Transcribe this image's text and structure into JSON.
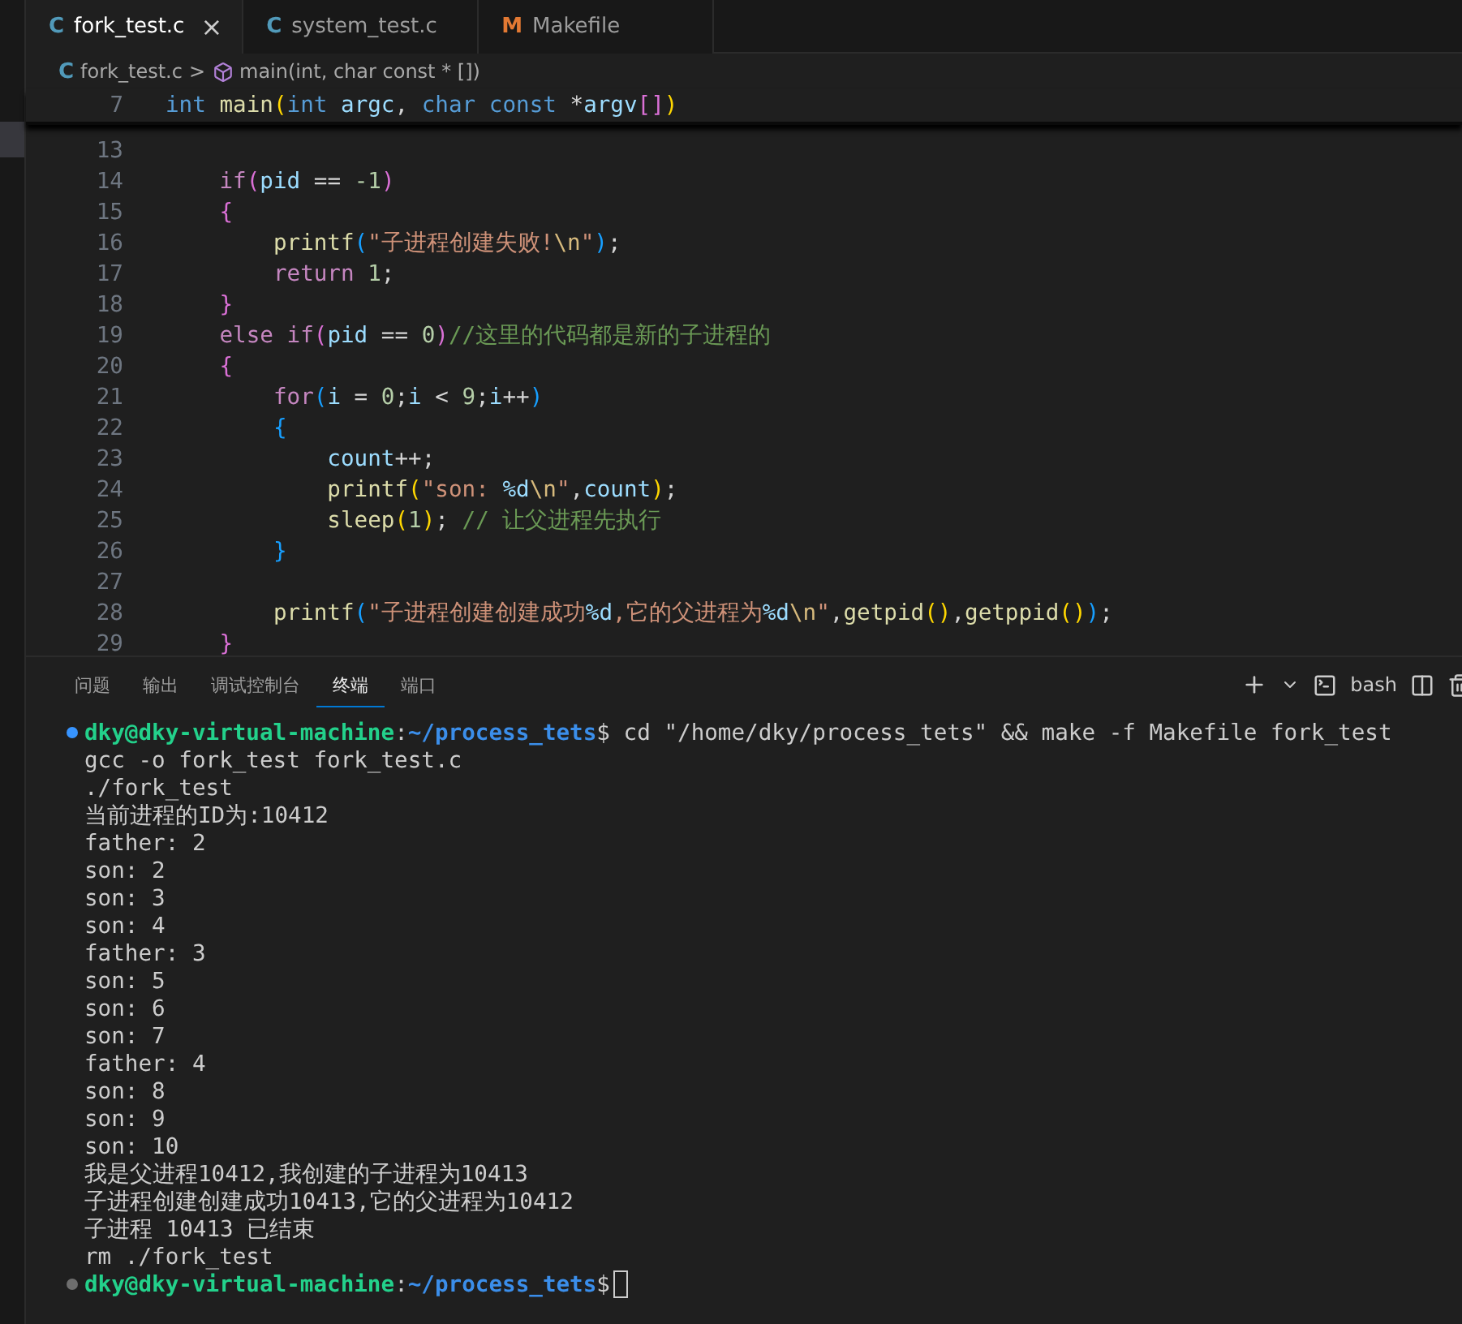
{
  "tabs": [
    {
      "icon": "C",
      "kind": "c",
      "label": "fork_test.c",
      "selected": true,
      "close": "×"
    },
    {
      "icon": "C",
      "kind": "c",
      "label": "system_test.c",
      "selected": false
    },
    {
      "icon": "M",
      "kind": "make",
      "label": "Makefile",
      "selected": false
    }
  ],
  "breadcrumb": {
    "icon": "C",
    "file": "fork_test.c",
    "separator": ">",
    "symbol": "main(int, char const * [])"
  },
  "sticky_line": {
    "number": "7",
    "tokens": [
      {
        "kind": "kw",
        "text": "int "
      },
      {
        "kind": "fn",
        "text": "main"
      },
      {
        "kind": "b1",
        "text": "("
      },
      {
        "kind": "kw",
        "text": "int "
      },
      {
        "kind": "var",
        "text": "argc"
      },
      {
        "kind": "op",
        "text": ", "
      },
      {
        "kind": "kw",
        "text": "char const "
      },
      {
        "kind": "op",
        "text": "*"
      },
      {
        "kind": "var",
        "text": "argv"
      },
      {
        "kind": "b2",
        "text": "[]"
      },
      {
        "kind": "b1",
        "text": ")"
      }
    ]
  },
  "code_lines": [
    {
      "number": "13"
    },
    {
      "number": "14",
      "tokens": [
        {
          "kind": "ctrl",
          "text": "    if"
        },
        {
          "kind": "b2",
          "text": "("
        },
        {
          "kind": "var",
          "text": "pid"
        },
        {
          "kind": "op",
          "text": " == "
        },
        {
          "kind": "num",
          "text": "-1"
        },
        {
          "kind": "b2",
          "text": ")"
        }
      ]
    },
    {
      "number": "15",
      "tokens": [
        {
          "kind": "b2",
          "text": "    {"
        }
      ]
    },
    {
      "number": "16",
      "tokens": [
        {
          "kind": "fn",
          "text": "        printf"
        },
        {
          "kind": "b3",
          "text": "("
        },
        {
          "kind": "str",
          "text": "\"子进程创建失败!"
        },
        {
          "kind": "esc",
          "text": "\\n"
        },
        {
          "kind": "str",
          "text": "\""
        },
        {
          "kind": "b3",
          "text": ")"
        },
        {
          "kind": "op",
          "text": ";"
        }
      ]
    },
    {
      "number": "17",
      "tokens": [
        {
          "kind": "ctrl",
          "text": "        return "
        },
        {
          "kind": "num",
          "text": "1"
        },
        {
          "kind": "op",
          "text": ";"
        }
      ]
    },
    {
      "number": "18",
      "tokens": [
        {
          "kind": "b2",
          "text": "    }"
        }
      ]
    },
    {
      "number": "19",
      "tokens": [
        {
          "kind": "ctrl",
          "text": "    else if"
        },
        {
          "kind": "b2",
          "text": "("
        },
        {
          "kind": "var",
          "text": "pid"
        },
        {
          "kind": "op",
          "text": " == "
        },
        {
          "kind": "num",
          "text": "0"
        },
        {
          "kind": "b2",
          "text": ")"
        },
        {
          "kind": "cmt",
          "text": "//这里的代码都是新的子进程的"
        }
      ]
    },
    {
      "number": "20",
      "tokens": [
        {
          "kind": "b2",
          "text": "    {"
        }
      ]
    },
    {
      "number": "21",
      "tokens": [
        {
          "kind": "ctrl",
          "text": "        for"
        },
        {
          "kind": "b3",
          "text": "("
        },
        {
          "kind": "var",
          "text": "i"
        },
        {
          "kind": "op",
          "text": " = "
        },
        {
          "kind": "num",
          "text": "0"
        },
        {
          "kind": "op",
          "text": ";"
        },
        {
          "kind": "var",
          "text": "i"
        },
        {
          "kind": "op",
          "text": " < "
        },
        {
          "kind": "num",
          "text": "9"
        },
        {
          "kind": "op",
          "text": ";"
        },
        {
          "kind": "var",
          "text": "i"
        },
        {
          "kind": "op",
          "text": "++"
        },
        {
          "kind": "b3",
          "text": ")"
        }
      ]
    },
    {
      "number": "22",
      "tokens": [
        {
          "kind": "b3",
          "text": "        {"
        }
      ]
    },
    {
      "number": "23",
      "tokens": [
        {
          "kind": "var",
          "text": "            count"
        },
        {
          "kind": "op",
          "text": "++;"
        }
      ]
    },
    {
      "number": "24",
      "tokens": [
        {
          "kind": "fn",
          "text": "            printf"
        },
        {
          "kind": "b1",
          "text": "("
        },
        {
          "kind": "str",
          "text": "\"son: "
        },
        {
          "kind": "var",
          "text": "%d"
        },
        {
          "kind": "esc",
          "text": "\\n"
        },
        {
          "kind": "str",
          "text": "\""
        },
        {
          "kind": "op",
          "text": ","
        },
        {
          "kind": "var",
          "text": "count"
        },
        {
          "kind": "b1",
          "text": ")"
        },
        {
          "kind": "op",
          "text": ";"
        }
      ]
    },
    {
      "number": "25",
      "tokens": [
        {
          "kind": "fn",
          "text": "            sleep"
        },
        {
          "kind": "b1",
          "text": "("
        },
        {
          "kind": "num",
          "text": "1"
        },
        {
          "kind": "b1",
          "text": ")"
        },
        {
          "kind": "op",
          "text": "; "
        },
        {
          "kind": "cmt",
          "text": "// 让父进程先执行"
        }
      ]
    },
    {
      "number": "26",
      "tokens": [
        {
          "kind": "b3",
          "text": "        }"
        }
      ]
    },
    {
      "number": "27"
    },
    {
      "number": "28",
      "tokens": [
        {
          "kind": "fn",
          "text": "        printf"
        },
        {
          "kind": "b3",
          "text": "("
        },
        {
          "kind": "str",
          "text": "\"子进程创建创建成功"
        },
        {
          "kind": "var",
          "text": "%d"
        },
        {
          "kind": "str",
          "text": ",它的父进程为"
        },
        {
          "kind": "var",
          "text": "%d"
        },
        {
          "kind": "esc",
          "text": "\\n"
        },
        {
          "kind": "str",
          "text": "\""
        },
        {
          "kind": "op",
          "text": ","
        },
        {
          "kind": "fn",
          "text": "getpid"
        },
        {
          "kind": "b1",
          "text": "()"
        },
        {
          "kind": "op",
          "text": ","
        },
        {
          "kind": "fn",
          "text": "getppid"
        },
        {
          "kind": "b1",
          "text": "()"
        },
        {
          "kind": "b3",
          "text": ")"
        },
        {
          "kind": "op",
          "text": ";"
        }
      ]
    },
    {
      "number": "29",
      "tokens": [
        {
          "kind": "b2",
          "text": "    }"
        }
      ]
    }
  ],
  "panel_tabs": [
    {
      "label": "问题",
      "selected": false
    },
    {
      "label": "输出",
      "selected": false
    },
    {
      "label": "调试控制台",
      "selected": false
    },
    {
      "label": "终端",
      "selected": true
    },
    {
      "label": "端口",
      "selected": false
    }
  ],
  "terminal_profile": "bash",
  "terminal": [
    {
      "kind": "prompt",
      "user": "dky@dky-virtual-machine",
      "sep": ":",
      "path": "~/process_tets",
      "sign": "$",
      "command": " cd \"/home/dky/process_tets\" && make -f Makefile fork_test",
      "color": "#3794ff"
    },
    {
      "kind": "output",
      "text": "gcc -o fork_test fork_test.c"
    },
    {
      "kind": "output",
      "text": "./fork_test"
    },
    {
      "kind": "output",
      "text": "当前进程的ID为:10412"
    },
    {
      "kind": "output",
      "text": "father: 2"
    },
    {
      "kind": "output",
      "text": "son: 2"
    },
    {
      "kind": "output",
      "text": "son: 3"
    },
    {
      "kind": "output",
      "text": "son: 4"
    },
    {
      "kind": "output",
      "text": "father: 3"
    },
    {
      "kind": "output",
      "text": "son: 5"
    },
    {
      "kind": "output",
      "text": "son: 6"
    },
    {
      "kind": "output",
      "text": "son: 7"
    },
    {
      "kind": "output",
      "text": "father: 4"
    },
    {
      "kind": "output",
      "text": "son: 8"
    },
    {
      "kind": "output",
      "text": "son: 9"
    },
    {
      "kind": "output",
      "text": "son: 10"
    },
    {
      "kind": "output",
      "text": "我是父进程10412,我创建的子进程为10413"
    },
    {
      "kind": "output",
      "text": "子进程创建创建成功10413,它的父进程为10412"
    },
    {
      "kind": "output",
      "text": "子进程 10413 已结束"
    },
    {
      "kind": "output",
      "text": "rm ./fork_test"
    },
    {
      "kind": "prompt",
      "user": "dky@dky-virtual-machine",
      "sep": ":",
      "path": "~/process_tets",
      "sign": "$",
      "cursor": true,
      "color": "#6e6e6e"
    }
  ]
}
